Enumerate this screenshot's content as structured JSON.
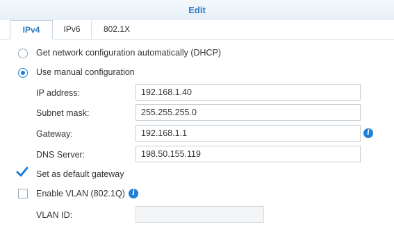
{
  "dialog": {
    "title": "Edit"
  },
  "tabs": [
    {
      "label": "IPv4",
      "active": true
    },
    {
      "label": "IPv6",
      "active": false
    },
    {
      "label": "802.1X",
      "active": false
    }
  ],
  "config_mode": {
    "dhcp_label": "Get network configuration automatically (DHCP)",
    "manual_label": "Use manual configuration",
    "selected": "manual"
  },
  "fields": {
    "ip_address": {
      "label": "IP address:",
      "value": "192.168.1.40"
    },
    "subnet_mask": {
      "label": "Subnet mask:",
      "value": "255.255.255.0"
    },
    "gateway": {
      "label": "Gateway:",
      "value": "192.168.1.1"
    },
    "dns_server": {
      "label": "DNS Server:",
      "value": "198.50.155.119"
    }
  },
  "default_gateway": {
    "label": "Set as default gateway",
    "checked": true
  },
  "vlan": {
    "label": "Enable VLAN (802.1Q)",
    "checked": false,
    "id_label": "VLAN ID:",
    "id_value": ""
  },
  "icons": {
    "info": "info-icon",
    "info_glyph": "i",
    "checkmark": "checkmark-icon"
  },
  "colors": {
    "accent": "#1e80d6",
    "title": "#2b79c2"
  }
}
